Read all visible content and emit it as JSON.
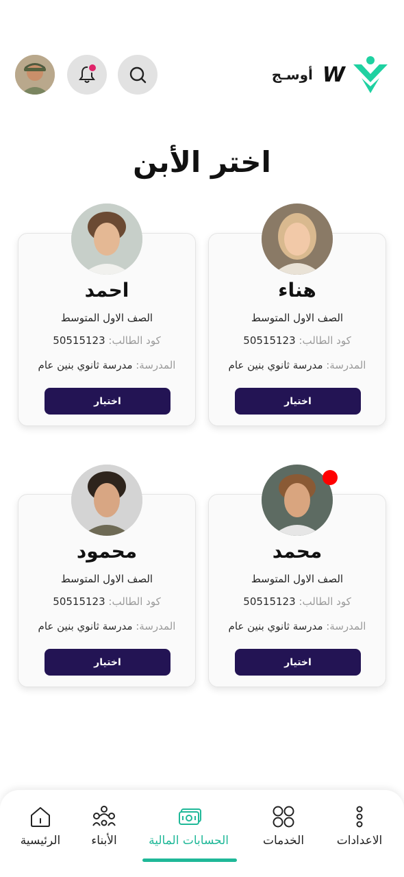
{
  "header": {
    "brand_name": "أوسـج",
    "brand_mark": "W",
    "brand_color": "#1fd1a1"
  },
  "page_title": "اختر الأبن",
  "labels": {
    "code_prefix": "كود الطالب: ",
    "school_prefix": "المدرسة: ",
    "select_button": "اختيار"
  },
  "children": [
    {
      "name": "هناء",
      "grade": "الصف الاول المتوسط",
      "code": "50515123",
      "school": "مدرسة ثانوي بنين عام",
      "has_notification": false
    },
    {
      "name": "احمد",
      "grade": "الصف الاول المتوسط",
      "code": "50515123",
      "school": "مدرسة ثانوي بنين عام",
      "has_notification": false
    },
    {
      "name": "محمد",
      "grade": "الصف الاول المتوسط",
      "code": "50515123",
      "school": "مدرسة ثانوي بنين عام",
      "has_notification": true
    },
    {
      "name": "محمود",
      "grade": "الصف الاول المتوسط",
      "code": "50515123",
      "school": "مدرسة ثانوي بنين عام",
      "has_notification": false
    }
  ],
  "bottom_nav": [
    {
      "label": "الاعدادات",
      "icon": "more-vertical-icon",
      "active": false
    },
    {
      "label": "الخدمات",
      "icon": "grid-icon",
      "active": false
    },
    {
      "label": "الحسابات المالية",
      "icon": "money-icon",
      "active": true
    },
    {
      "label": "الأبناء",
      "icon": "children-icon",
      "active": false
    },
    {
      "label": "الرئيسية",
      "icon": "home-icon",
      "active": false
    }
  ],
  "colors": {
    "button_bg": "#231454",
    "accent": "#1fb898",
    "notification_dot": "#ff0000"
  }
}
